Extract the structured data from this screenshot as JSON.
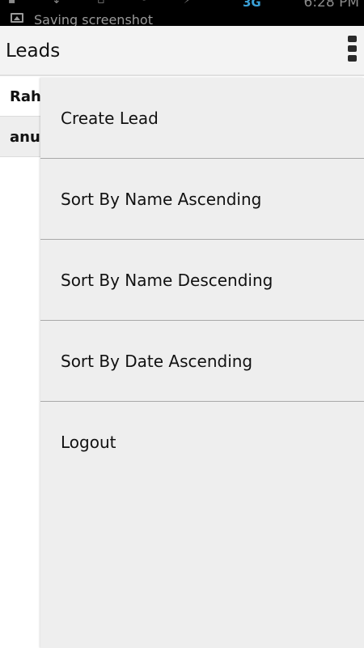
{
  "status_bar": {
    "notification_text": "Saving screenshot",
    "network_label": "3G",
    "time": "6:28 PM",
    "notification_icon": "image-icon"
  },
  "action_bar": {
    "title": "Leads",
    "overflow_icon": "overflow-menu-icon"
  },
  "leads": [
    {
      "name": "Rahul"
    },
    {
      "name": "anup"
    }
  ],
  "menu": {
    "items": [
      {
        "label": "Create Lead"
      },
      {
        "label": "Sort By Name Ascending"
      },
      {
        "label": "Sort By Name Descending"
      },
      {
        "label": "Sort By Date Ascending"
      },
      {
        "label": "Logout"
      }
    ]
  },
  "colors": {
    "status_bar_bg": "#000000",
    "action_bar_bg": "#f3f3f3",
    "menu_bg": "#eeeeee",
    "network_accent": "#3aa0d6"
  }
}
